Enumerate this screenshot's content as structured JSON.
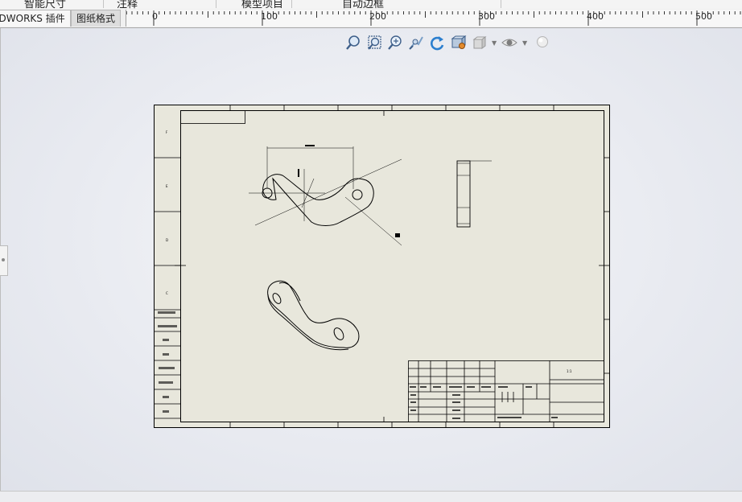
{
  "topbar": {
    "fragments": [
      "智能尺寸",
      "注释",
      "模型项目",
      "自动边框"
    ]
  },
  "tabs": [
    {
      "label": "IDWORKS 插件",
      "active": false
    },
    {
      "label": "图纸格式",
      "active": true
    }
  ],
  "ruler": {
    "labels": [
      "0",
      "100",
      "200",
      "300",
      "400",
      "500"
    ]
  },
  "hud_icons": [
    "zoom-to-fit-icon",
    "zoom-to-area-icon",
    "zoom-in-out-icon",
    "previous-view-icon",
    "rotate-view-icon",
    "view-orientation-icon",
    "display-style-icon",
    "hide-show-items-icon",
    "scene-icon"
  ],
  "sheet": {
    "zone_letters": [
      "F",
      "E",
      "D",
      "C"
    ],
    "title_block_text": "1:1"
  },
  "colors": {
    "sheet_paper": "#e8e7dc",
    "sheet_border": "#000000",
    "canvas_bg": "#e9ebf1"
  }
}
